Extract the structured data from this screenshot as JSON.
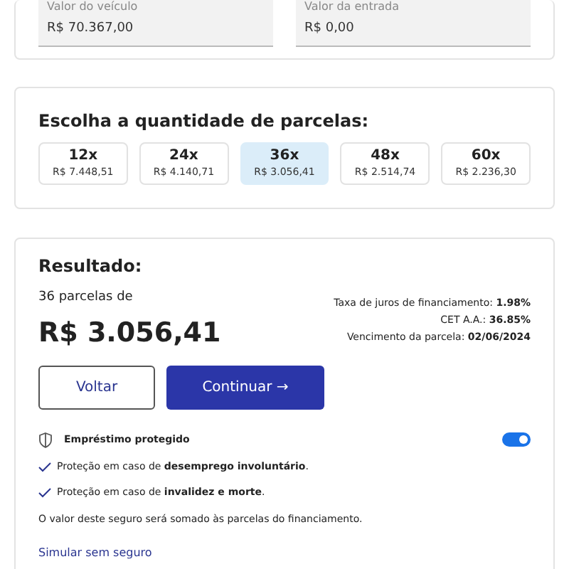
{
  "vehicle_fields": [
    {
      "label": "Valor do veículo",
      "value": "R$ 70.367,00"
    },
    {
      "label": "Valor da entrada",
      "value": "R$ 0,00"
    }
  ],
  "installments": {
    "title": "Escolha a quantidade de parcelas:",
    "options": [
      {
        "count": "12x",
        "amount": "R$ 7.448,51",
        "selected": false
      },
      {
        "count": "24x",
        "amount": "R$ 4.140,71",
        "selected": false
      },
      {
        "count": "36x",
        "amount": "R$ 3.056,41",
        "selected": true
      },
      {
        "count": "48x",
        "amount": "R$ 2.514,74",
        "selected": false
      },
      {
        "count": "60x",
        "amount": "R$ 2.236,30",
        "selected": false
      }
    ]
  },
  "result": {
    "title": "Resultado:",
    "subtitle": "36 parcelas de",
    "amount": "R$ 3.056,41",
    "details": [
      "Taxa de juros de financiamento: **1.98%**",
      "CET A.A.: **36.85%**",
      "Vencimento da parcela: **02/06/2024**"
    ],
    "back_button": "Voltar",
    "continue_button": "Continuar →",
    "insurance": {
      "title": "Empréstimo protegido",
      "on": true,
      "benefits": [
        "Proteção em caso de **desemprego involuntário**.",
        "Proteção em caso de **invalidez e morte**."
      ],
      "note": "O valor deste seguro será somado às parcelas do financiamento.",
      "link": "Simular sem seguro"
    }
  }
}
